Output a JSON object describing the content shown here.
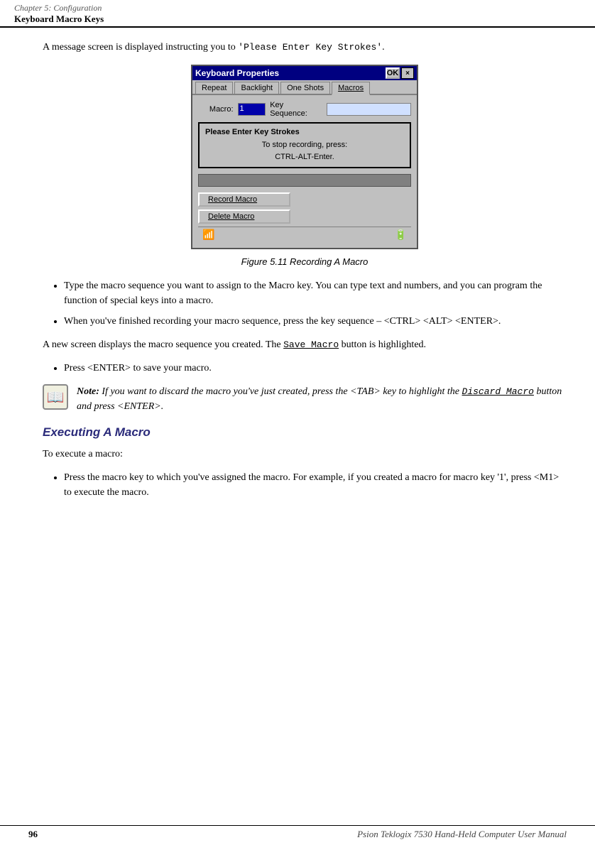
{
  "header": {
    "chapter_label": "Chapter  5:  Configuration",
    "section_label": "Keyboard Macro Keys"
  },
  "intro": {
    "text_before": "A message screen is displayed instructing you to ",
    "code_text": "'Please Enter Key Strokes'",
    "text_after": "."
  },
  "window": {
    "title": "Keyboard Properties",
    "ok_btn": "OK",
    "close_btn": "×",
    "tabs": [
      "Repeat",
      "Backlight",
      "One Shots",
      "Macros"
    ],
    "active_tab": "Macros",
    "macro_label": "Macro:",
    "key_seq_label": "Key Sequence:",
    "macro_value": "1",
    "dialog_title": "Please Enter Key Strokes",
    "dialog_line1": "To stop recording, press:",
    "dialog_line2": "CTRL-ALT-Enter.",
    "record_button": "Record Macro",
    "record_underline": "R",
    "delete_button": "Delete Macro",
    "delete_underline": "D"
  },
  "figure_caption": "Figure 5.11  Recording A Macro",
  "bullets": [
    "Type the macro sequence you want to assign to the Macro key. You can type text and numbers, and you can program the function of special keys into a macro.",
    "When you've finished recording your macro sequence, press the key sequence – <CTRL> <ALT> <ENTER>."
  ],
  "para1": {
    "text_before": "A new screen displays the macro sequence you created. The ",
    "code": "Save Macro",
    "text_after": " button is highlighted."
  },
  "bullet2": [
    "Press <ENTER> to save your macro."
  ],
  "note": {
    "label": "Note:",
    "text_before": "If you want to discard the macro you've just created, press the <TAB> key to highlight the ",
    "code": "Discard Macro",
    "text_after": " button and press <ENTER>."
  },
  "section_heading": "Executing A Macro",
  "section_intro": "To execute a macro:",
  "exec_bullets": [
    "Press the macro key to which you've assigned the macro. For example, if you created a macro for macro key '1', press <M1> to execute the macro."
  ],
  "footer": {
    "page_num": "96",
    "footer_text": "Psion Teklogix 7530 Hand-Held Computer User Manual"
  }
}
